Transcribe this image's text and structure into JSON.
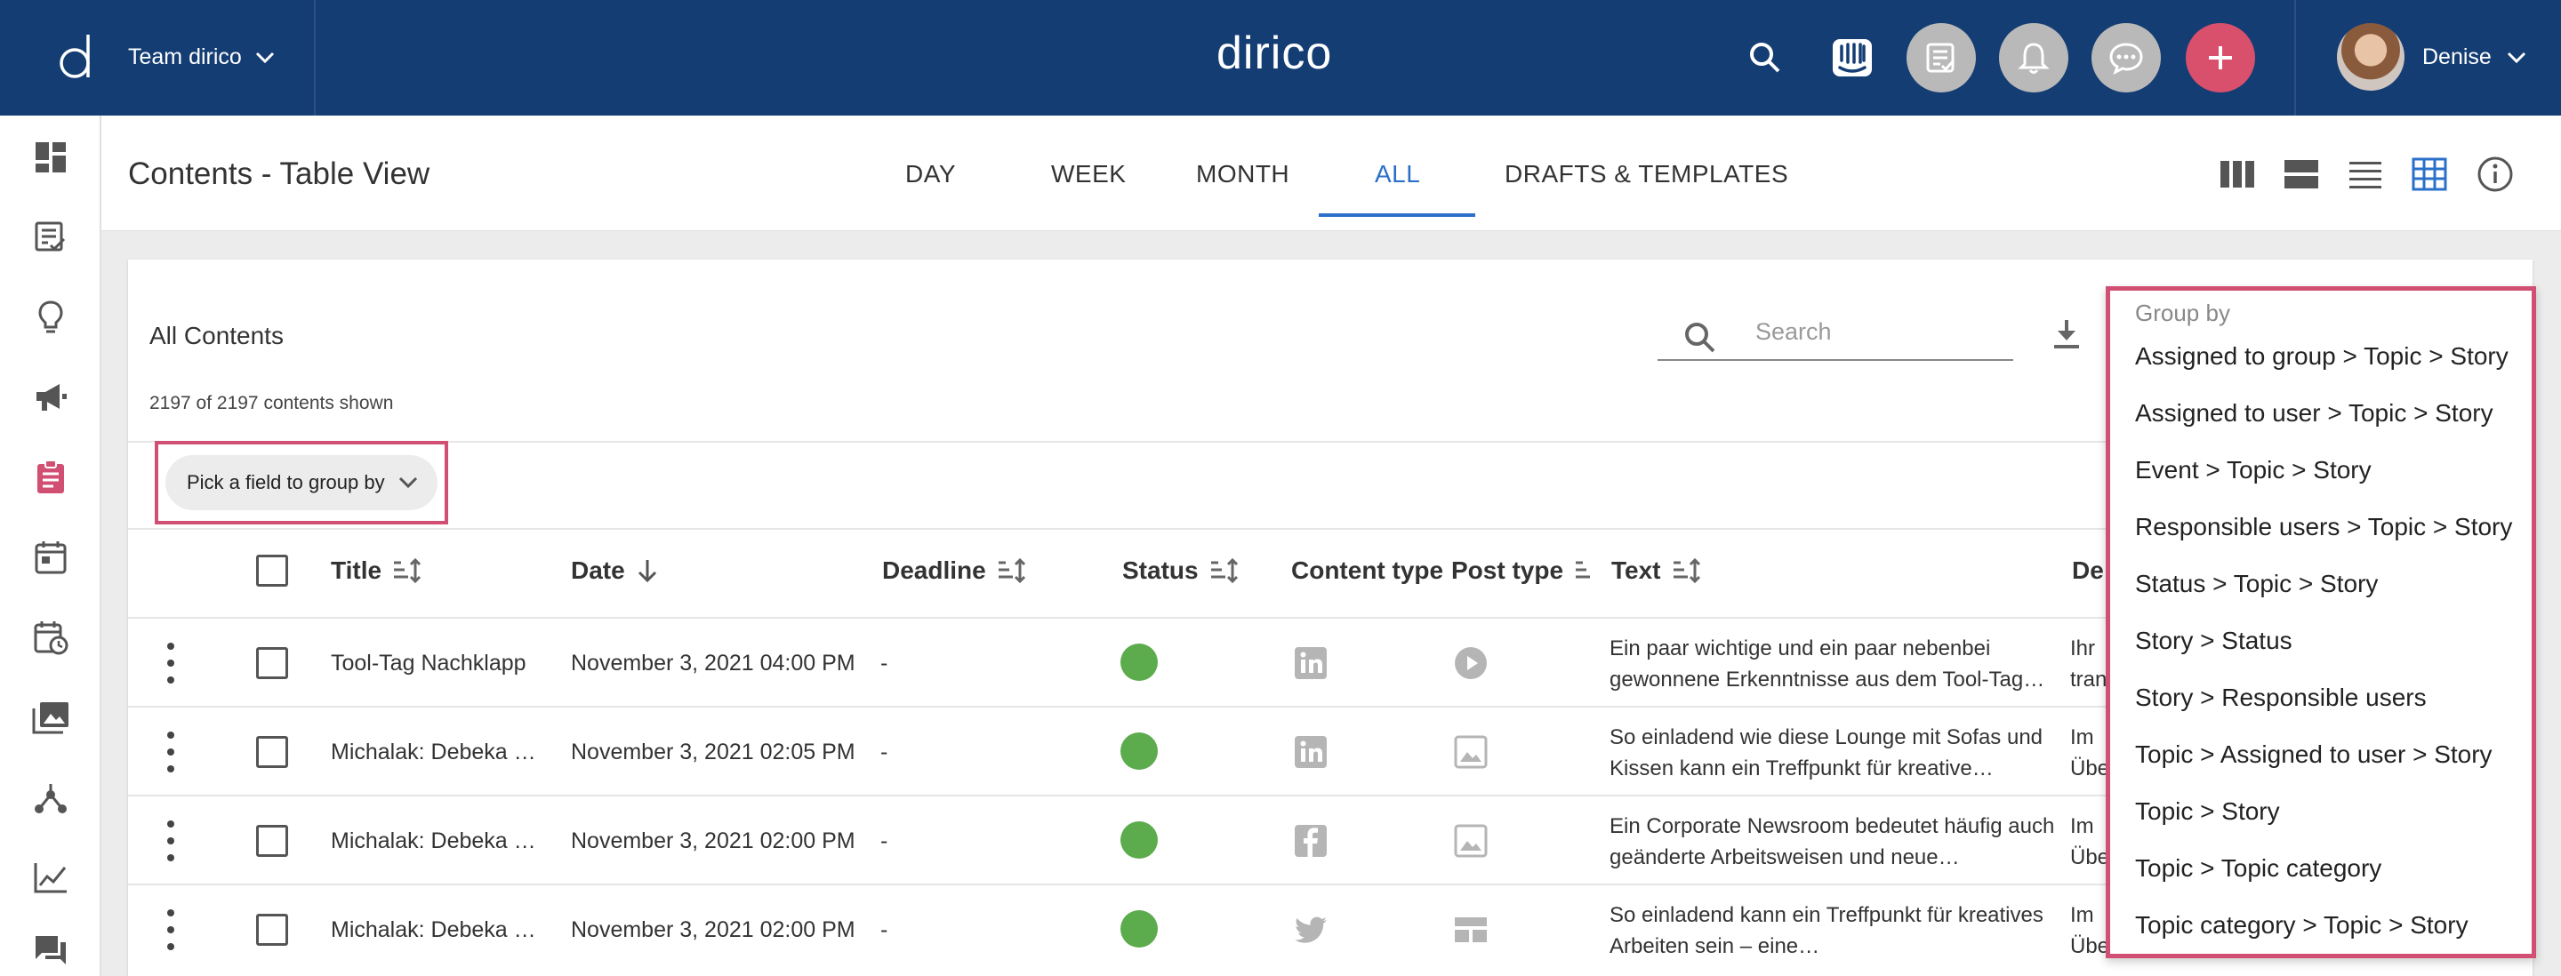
{
  "topbar": {
    "team": "Team dirico",
    "brand": "dirico",
    "user": "Denise"
  },
  "header": {
    "title": "Contents - Table View",
    "tabs": [
      "DAY",
      "WEEK",
      "MONTH",
      "ALL",
      "DRAFTS & TEMPLATES"
    ],
    "active_tab": "ALL"
  },
  "card": {
    "title": "All Contents",
    "shown": "2197 of 2197 contents shown",
    "search_placeholder": "Search",
    "group_by_label": "Pick a field to group by"
  },
  "table": {
    "columns": [
      "Title",
      "Date",
      "Deadline",
      "Status",
      "Content type",
      "Post type",
      "Text",
      "De"
    ],
    "rows": [
      {
        "title": "Tool-Tag Nachklapp",
        "date": "November 3, 2021 04:00 PM",
        "deadline": "-",
        "content_type": "linkedin-icon",
        "post_type": "video-icon",
        "text": "Ein paar wichtige und ein paar nebenbei gewonnene Erkenntnisse aus dem Tool-Tag…",
        "desc_1": "Ihr",
        "desc_2": "tran"
      },
      {
        "title": "Michalak: Debeka …",
        "date": "November 3, 2021 02:05 PM",
        "deadline": "-",
        "content_type": "linkedin-icon",
        "post_type": "image-icon",
        "text": "So einladend wie diese Lounge mit Sofas und Kissen kann ein Treffpunkt für kreative…",
        "desc_1": "Im",
        "desc_2": "Übe"
      },
      {
        "title": "Michalak: Debeka …",
        "date": "November 3, 2021 02:00 PM",
        "deadline": "-",
        "content_type": "facebook-icon",
        "post_type": "image-icon",
        "text": "Ein Corporate Newsroom bedeutet häufig auch geänderte Arbeitsweisen und neue…",
        "desc_1": "Im",
        "desc_2": "Übe"
      },
      {
        "title": "Michalak: Debeka …",
        "date": "November 3, 2021 02:00 PM",
        "deadline": "-",
        "content_type": "twitter-icon",
        "post_type": "carousel-icon",
        "text": "So einladend kann ein Treffpunkt für kreatives Arbeiten sein – eine…",
        "desc_1": "Im",
        "desc_2": "Übe"
      }
    ]
  },
  "dropdown": {
    "label": "Group by",
    "items": [
      "Assigned to group > Topic > Story",
      "Assigned to user > Topic > Story",
      "Event > Topic > Story",
      "Responsible users > Topic > Story",
      "Status > Topic > Story",
      "Story > Status",
      "Story > Responsible users",
      "Topic > Assigned to user > Story",
      "Topic > Story",
      "Topic > Topic category",
      "Topic category > Topic > Story"
    ]
  },
  "colors": {
    "topbar": "#143d73",
    "accent": "#2a70c9",
    "highlight": "#d14f72",
    "status_green": "#5cab4c"
  }
}
